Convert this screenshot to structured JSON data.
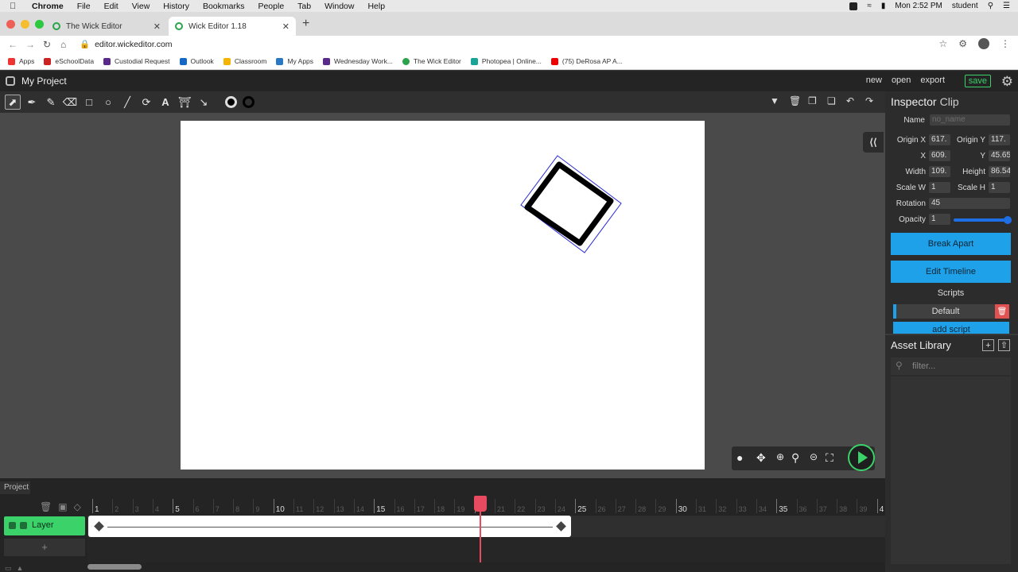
{
  "macos": {
    "menus": [
      "Chrome",
      "File",
      "Edit",
      "View",
      "History",
      "Bookmarks",
      "People",
      "Tab",
      "Window",
      "Help"
    ],
    "clock": "Mon 2:52 PM",
    "user": "student"
  },
  "browser": {
    "tabs": [
      {
        "title": "The Wick Editor"
      },
      {
        "title": "Wick Editor 1.18"
      }
    ],
    "url": "editor.wickeditor.com",
    "bookmarks": [
      "Apps",
      "eSchoolData",
      "Custodial Request",
      "Outlook",
      "Classroom",
      "My Apps",
      "Wednesday Work...",
      "The Wick Editor",
      "Photopea | Online...",
      "(75) DeRosa AP A..."
    ]
  },
  "app": {
    "project_title": "My Project",
    "menu": {
      "new": "new",
      "open": "open",
      "export": "export",
      "save": "save"
    }
  },
  "toolbar": {
    "tools": [
      "cursor-tool",
      "brush-tool",
      "pencil-tool",
      "eraser-tool",
      "rectangle-tool",
      "ellipse-tool",
      "line-tool",
      "path-cursor-tool",
      "text-tool",
      "fill-bucket-tool",
      "eyedropper-tool"
    ],
    "fill_color": "#000000",
    "stroke_color": "#000000"
  },
  "inspector": {
    "title": "Inspector",
    "subtitle": "Clip",
    "name_label": "Name",
    "name_placeholder": "no_name",
    "origin_x_label": "Origin X",
    "origin_x": "617.",
    "origin_y_label": "Origin Y",
    "origin_y": "117.",
    "x_label": "X",
    "x": "609.",
    "y_label": "Y",
    "y": "45.65",
    "width_label": "Width",
    "width": "109.",
    "height_label": "Height",
    "height": "86.54",
    "scale_w_label": "Scale W",
    "scale_w": "1",
    "scale_h_label": "Scale H",
    "scale_h": "1",
    "rotation_label": "Rotation",
    "rotation": "45",
    "opacity_label": "Opacity",
    "opacity": "1",
    "break_apart": "Break Apart",
    "edit_timeline": "Edit Timeline",
    "scripts_label": "Scripts",
    "script_default": "Default",
    "add_script": "add script"
  },
  "asset_library": {
    "title": "Asset Library",
    "filter_placeholder": "filter..."
  },
  "timeline": {
    "tab": "Project",
    "layer_name": "Layer",
    "add_layer": "+",
    "playhead_frame": 20,
    "tween_start": 1,
    "tween_end": 24,
    "ticks_major": [
      "1",
      "5",
      "10",
      "15",
      "20",
      "25",
      "30",
      "35",
      "4"
    ],
    "ticks_minor": [
      "2",
      "3",
      "4",
      "6",
      "7",
      "8",
      "9",
      "11",
      "12",
      "13",
      "14",
      "16",
      "17",
      "18",
      "19",
      "21",
      "22",
      "23",
      "24",
      "26",
      "27",
      "28",
      "29",
      "31",
      "32",
      "33",
      "34",
      "36",
      "37",
      "38",
      "39"
    ]
  },
  "colors": {
    "accent_green": "#3bd26a",
    "accent_blue": "#1ea1e8",
    "playhead_red": "#e84a5f"
  }
}
